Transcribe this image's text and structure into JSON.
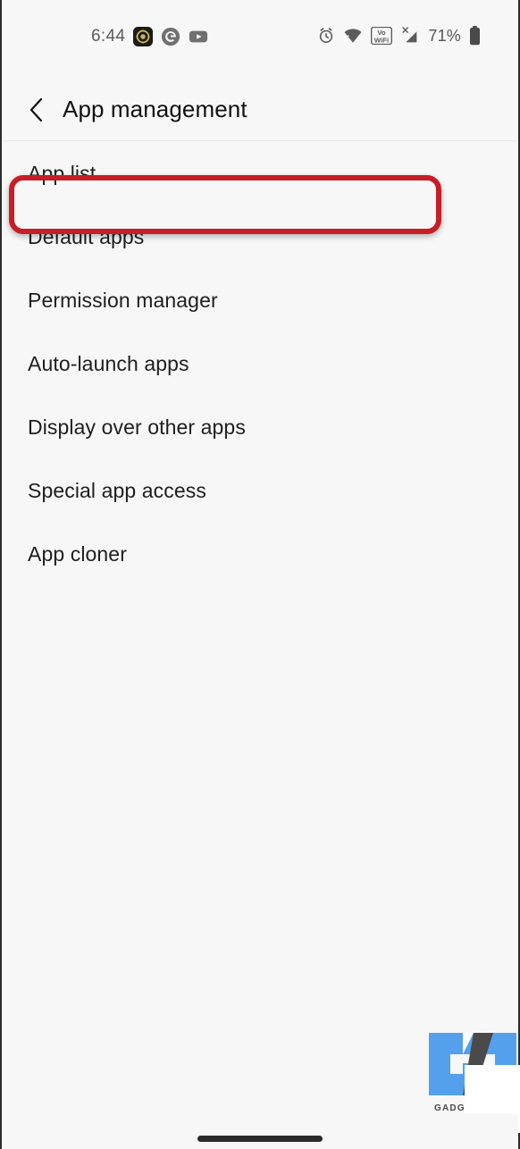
{
  "statusbar": {
    "time": "6:44",
    "battery_percent": "71%",
    "left_icons": [
      {
        "name": "app-notification-icon",
        "label": "app-badge"
      },
      {
        "name": "google-icon",
        "label": "G"
      },
      {
        "name": "youtube-icon",
        "label": "youtube"
      }
    ],
    "right_icons": [
      {
        "name": "alarm-clock-icon",
        "label": "alarm"
      },
      {
        "name": "wifi-icon",
        "label": "wifi"
      },
      {
        "name": "vowifi-icon",
        "label": "VoWiFi"
      },
      {
        "name": "cellular-signal-icon",
        "label": "signal-no-sim"
      },
      {
        "name": "battery-icon",
        "label": "battery"
      }
    ],
    "vowifi_line1": "Vo",
    "vowifi_line2": "WiFi",
    "signal_x": "X"
  },
  "header": {
    "back_label": "Back",
    "title": "App management"
  },
  "list": {
    "items": [
      {
        "label": "App list",
        "name": "app-list"
      },
      {
        "label": "Default apps",
        "name": "default-apps"
      },
      {
        "label": "Permission manager",
        "name": "permission-manager"
      },
      {
        "label": "Auto-launch apps",
        "name": "auto-launch-apps"
      },
      {
        "label": "Display over other apps",
        "name": "display-over-other-apps"
      },
      {
        "label": "Special app access",
        "name": "special-app-access"
      },
      {
        "label": "App cloner",
        "name": "app-cloner"
      }
    ]
  },
  "annotation": {
    "highlight_target": "App list",
    "highlight_color": "#c71d26"
  },
  "watermark": {
    "text": "GADGETSTOUSE",
    "primary_color": "#55a0ec",
    "secondary_color": "#4a4a4a"
  },
  "colors": {
    "background": "#f7f7f7",
    "text_primary": "#1e1e1e",
    "text_secondary": "#5b5b5b",
    "divider": "#e8e8e8",
    "nav_pill": "#2a2a2a"
  }
}
